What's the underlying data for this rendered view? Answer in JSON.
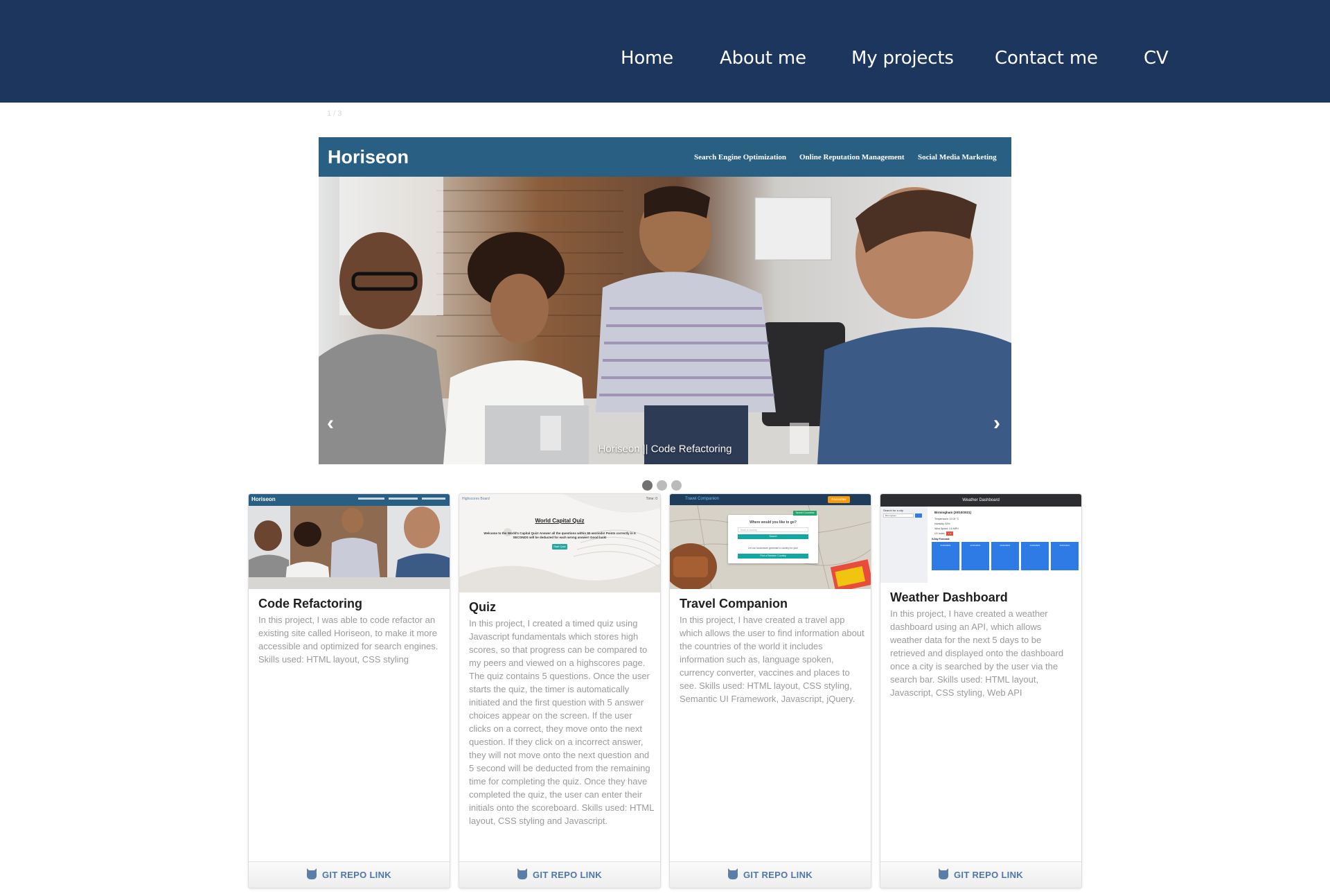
{
  "nav": {
    "items": [
      "Home",
      "About me",
      "My projects",
      "Contact me",
      "CV"
    ]
  },
  "carousel": {
    "counter": "1 / 3",
    "brand": "Horiseon",
    "site_nav": [
      "Search Engine Optimization",
      "Online Reputation Management",
      "Social Media Marketing"
    ],
    "caption": "Horiseon || Code Refactoring",
    "prev_icon": "‹",
    "next_icon": "›",
    "active_slide": 1,
    "slide_count": 3
  },
  "thumbnails": {
    "quiz": {
      "header_left": "Highscores Board",
      "header_right": "Time: 0",
      "title": "World Capital Quiz",
      "body": "Welcome to the World's Capital Quiz! Answer all the questions within 90 seconds! Points correctly in 5 SECONDS will be deducted for each wrong answer! Good luck!",
      "button": "Start Quiz"
    },
    "travel": {
      "brand": "Travel Companion",
      "header_btn": "Favourites",
      "badge": "Search Countries",
      "question": "Where would you like to go?",
      "placeholder": "Enter a country",
      "search_btn": "Search",
      "hint": "Let our randomizer generate a country for you!",
      "random_btn": "Find a Random Country"
    },
    "weather": {
      "title": "Weather Dashboard",
      "search_label": "Search for a city",
      "search_value": "Birmingham",
      "city": "Birmingham (20/10/2021)",
      "temp": "Temperature: 12.04 °C",
      "humidity": "Humidity: 83%",
      "wind": "Wind Speed: 3.6 MPH",
      "uv_label": "UV Index:",
      "uv_value": "1.4",
      "forecast_label": "5-Day Forecast:",
      "days": [
        "21/10/2021",
        "22/10/2021",
        "23/10/2021",
        "24/10/2021",
        "25/10/2021"
      ]
    }
  },
  "projects": [
    {
      "title": "Code Refactoring",
      "description": "In this project, I was able to code refactor an existing site called Horiseon, to make it more accessible and optimized for search engines. Skills used: HTML layout, CSS styling",
      "link_label": "GIT REPO LINK"
    },
    {
      "title": "Quiz",
      "description": "In this project, I created a timed quiz using Javascript fundamentals which stores high scores, so that progress can be compared to my peers and viewed on a highscores page. The quiz contains 5 questions. Once the user starts the quiz, the timer is automatically initiated and the first question with 5 answer choices appear on the screen. If the user clicks on a correct, they move onto the next question. If they click on a incorrect answer, they will not move onto the next question and 5 second will be deducted from the remaining time for completing the quiz. Once they have completed the quiz, the user can enter their initials onto the scoreboard. Skills used: HTML layout, CSS styling and Javascript.",
      "link_label": "GIT REPO LINK"
    },
    {
      "title": "Travel Companion",
      "description": "In this project, I have created a travel app which allows the user to find information about the countries of the world it includes information such as, language spoken, currency converter, vaccines and places to see. Skills used: HTML layout, CSS styling, Semantic UI Framework, Javascript, jQuery.",
      "link_label": "GIT REPO LINK"
    },
    {
      "title": "Weather Dashboard",
      "description": "In this project, I have created a weather dashboard using an API, which allows weather data for the next 5 days to be retrieved and displayed onto the dashboard once a city is searched by the user via the search bar. Skills used: HTML layout, Javascript, CSS styling, Web API",
      "link_label": "GIT REPO LINK"
    }
  ],
  "colors": {
    "nav_bg": "#1d365d",
    "horiseon_header": "#2a5f84",
    "link": "#4f77a7"
  }
}
